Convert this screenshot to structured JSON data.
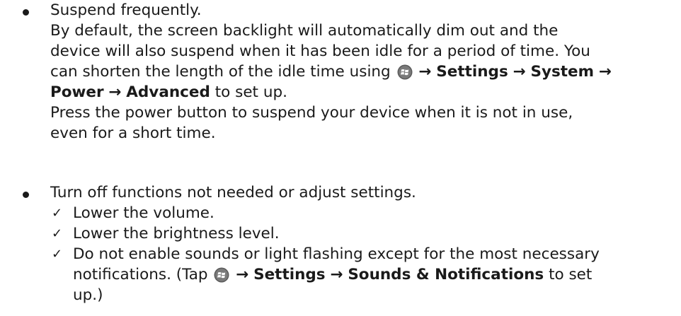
{
  "items": [
    {
      "heading": "Suspend frequently.",
      "lines": [
        "By default, the screen backlight will automatically dim out and the",
        "device will also suspend when it has been idle for a period of time. You",
        "can shorten the length of the idle time using",
        "to set up.",
        "Press the power button to suspend your device when it is not in use,",
        "even for a short time."
      ],
      "path": [
        "Settings",
        "System",
        "Power",
        "Advanced"
      ]
    },
    {
      "heading": "Turn off functions not needed or adjust settings.",
      "checks": [
        "Lower the volume.",
        "Lower the brightness level.",
        "Do not enable sounds or light flashing except for the most necessary",
        "notifications. (Tap",
        "to set",
        "up.)"
      ],
      "path": [
        "Settings",
        "Sounds & Notifications"
      ]
    }
  ],
  "icons": {
    "start": "windows-start-icon",
    "arrow": "right-arrow-icon",
    "check": "checkmark-icon",
    "bullet": "bullet-icon"
  },
  "colors": {
    "text": "#1a1a1a",
    "icon_dark": "#5a5a5a"
  }
}
